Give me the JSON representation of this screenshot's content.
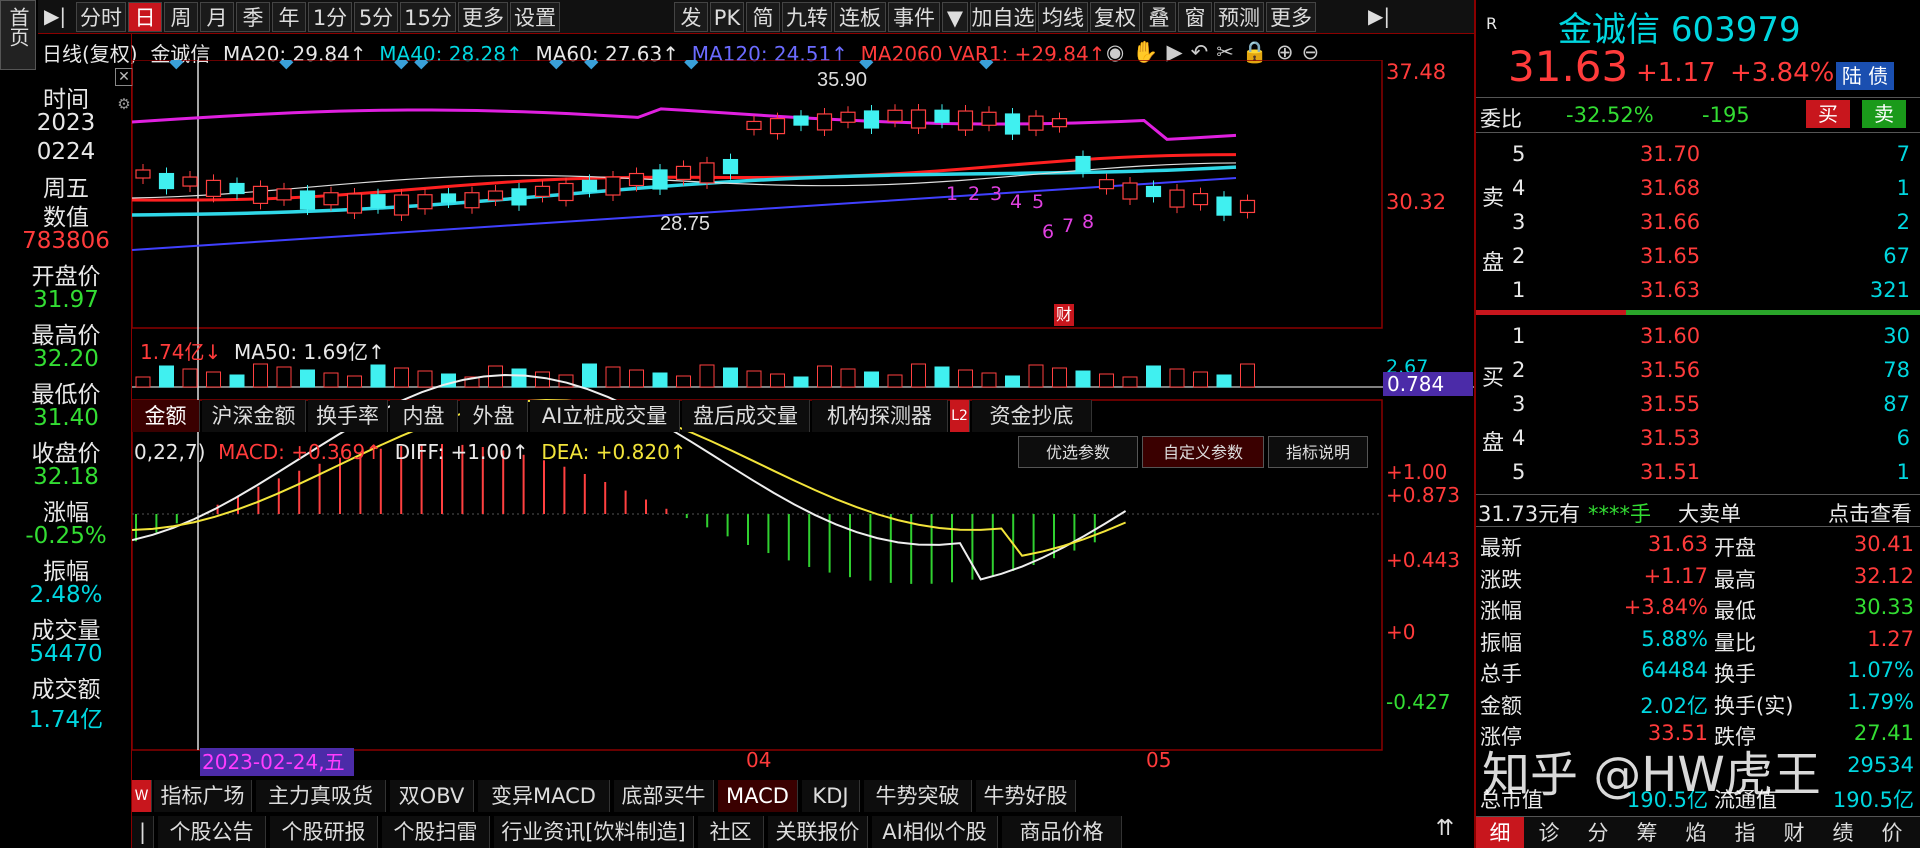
{
  "toolbar": {
    "items": [
      "分时",
      "日",
      "周",
      "月",
      "季",
      "年",
      "1分",
      "5分",
      "15分",
      "更多",
      "设置"
    ],
    "active": "日",
    "items2": [
      "发",
      "PK",
      "简",
      "九转",
      "连板",
      "事件",
      "▼",
      "加自选",
      "均线",
      "复权",
      "叠",
      "窗",
      "预测",
      "更多"
    ]
  },
  "left": {
    "home": "首页",
    "rows": [
      {
        "label": "时间",
        "color": "white"
      },
      {
        "label": "2023",
        "color": "white"
      },
      {
        "label": "0224",
        "color": "white"
      },
      {
        "label": "周五",
        "color": "white"
      },
      {
        "label": "数值",
        "color": "white"
      },
      {
        "label": "783806",
        "color": "red"
      },
      {
        "label": "开盘价",
        "color": "white"
      },
      {
        "label": "31.97",
        "color": "green"
      },
      {
        "label": "最高价",
        "color": "white"
      },
      {
        "label": "32.20",
        "color": "green"
      },
      {
        "label": "最低价",
        "color": "white"
      },
      {
        "label": "31.40",
        "color": "green"
      },
      {
        "label": "收盘价",
        "color": "white"
      },
      {
        "label": "32.18",
        "color": "green"
      },
      {
        "label": "涨幅",
        "color": "white"
      },
      {
        "label": "-0.25%",
        "color": "green"
      },
      {
        "label": "振幅",
        "color": "white"
      },
      {
        "label": "2.48%",
        "color": "cyan"
      },
      {
        "label": "成交量",
        "color": "white"
      },
      {
        "label": "54470",
        "color": "cyan"
      },
      {
        "label": "成交额",
        "color": "white"
      },
      {
        "label": "1.74亿",
        "color": "cyan"
      }
    ]
  },
  "chart_info": {
    "mode": "日线(复权)",
    "name": "金诚信",
    "ma20": "MA20: 29.84↑",
    "ma40": "MA40: 28.28↑",
    "ma60": "MA60: 27.63↑",
    "ma120": "MA120: 24.51↑",
    "ma2060": "MA2060 VAR1: +29.84↑"
  },
  "price_axis": {
    "top": "37.48",
    "mid": "30.32"
  },
  "annotations": {
    "high": "35.90",
    "low": "28.75",
    "cai": "财",
    "seq": [
      "1",
      "2",
      "3",
      "4",
      "5",
      "6",
      "7",
      "8"
    ]
  },
  "volume": {
    "label": "1.74亿↓",
    "ma50": "MA50: 1.69亿↑",
    "axis_top": "2.67",
    "axis_val": "0.784"
  },
  "sub_tabs": [
    "金额",
    "沪深金额",
    "换手率",
    "内盘",
    "外盘",
    "AI立桩成交量",
    "盘后成交量",
    "机构探测器",
    "L2",
    "资金抄底"
  ],
  "macd": {
    "params": "0,22,7)",
    "macd": "MACD: +0.369↑",
    "diff": "DIFF: +1.00↑",
    "dea": "DEA: +0.820↑",
    "buttons": [
      "优选参数",
      "自定义参数",
      "指标说明"
    ],
    "axis": [
      "+1.00",
      "+0.873",
      "+0.443",
      "+0",
      "-0.427"
    ]
  },
  "date_axis": {
    "cursor": "2023-02-24,五",
    "m04": "04",
    "m05": "05"
  },
  "ind_tabs": [
    "指标广场",
    "主力真吸货",
    "双OBV",
    "变异MACD",
    "底部买牛",
    "MACD",
    "KDJ",
    "牛势突破",
    "牛势好股"
  ],
  "bottom_tabs": [
    "个股公告",
    "个股研报",
    "个股扫雷",
    "行业资讯[饮料制造]",
    "社区",
    "关联报价",
    "AI相似个股",
    "商品价格"
  ],
  "right": {
    "r": "R",
    "name": "金诚信",
    "code": "603979",
    "price": "31.63",
    "change": "+1.17",
    "pct": "+3.84%",
    "badge": "陆 债",
    "weibi_label": "委比",
    "weibi": "-32.52%",
    "weicha": "-195",
    "buy": "买",
    "sell": "卖",
    "sell_label": [
      "卖",
      "盘"
    ],
    "buy_label": [
      "买",
      "盘"
    ],
    "asks": [
      {
        "n": "5",
        "p": "31.70",
        "v": "7"
      },
      {
        "n": "4",
        "p": "31.68",
        "v": "1"
      },
      {
        "n": "3",
        "p": "31.66",
        "v": "2"
      },
      {
        "n": "2",
        "p": "31.65",
        "v": "67"
      },
      {
        "n": "1",
        "p": "31.63",
        "v": "321"
      }
    ],
    "bids": [
      {
        "n": "1",
        "p": "31.60",
        "v": "30"
      },
      {
        "n": "2",
        "p": "31.56",
        "v": "78"
      },
      {
        "n": "3",
        "p": "31.55",
        "v": "87"
      },
      {
        "n": "4",
        "p": "31.53",
        "v": "6"
      },
      {
        "n": "5",
        "p": "31.51",
        "v": "1"
      }
    ],
    "bigorder": {
      "a": "31.73元有",
      "b": "****手",
      "c": "大卖单",
      "d": "点击查看"
    },
    "stats": [
      [
        "最新",
        "31.63",
        "开盘",
        "30.41"
      ],
      [
        "涨跌",
        "+1.17",
        "最高",
        "32.12"
      ],
      [
        "涨幅",
        "+3.84%",
        "最低",
        "30.33"
      ],
      [
        "振幅",
        "5.88%",
        "量比",
        "1.27"
      ],
      [
        "总手",
        "64484",
        "换手",
        "1.07%"
      ],
      [
        "金额",
        "2.02亿",
        "换手(实)",
        "1.79%"
      ],
      [
        "涨停",
        "33.51",
        "跌停",
        "27.41"
      ],
      [
        "",
        "",
        "",
        "29534"
      ],
      [
        "总市值",
        "190.5亿",
        "流通值",
        "190.5亿"
      ]
    ],
    "bottom": [
      "细",
      "诊",
      "分",
      "筹",
      "焰",
      "指",
      "财",
      "绩",
      "价"
    ],
    "watermark": "知乎 @HW虎王"
  }
}
